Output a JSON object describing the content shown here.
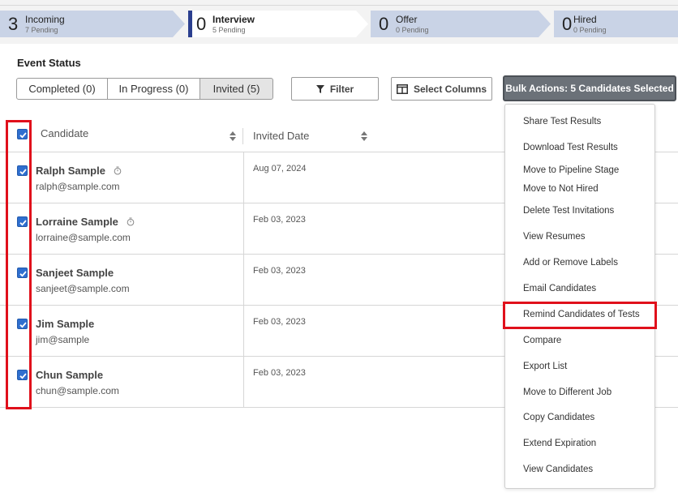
{
  "pipeline": {
    "stages": [
      {
        "count": "3",
        "name": "Incoming",
        "pending": "7 Pending"
      },
      {
        "count": "0",
        "name": "Interview",
        "pending": "5 Pending"
      },
      {
        "count": "0",
        "name": "Offer",
        "pending": "0 Pending"
      },
      {
        "count": "0",
        "name": "Hired",
        "pending": "0 Pending"
      }
    ],
    "active_stage": "Interview"
  },
  "event_status": {
    "label": "Event Status",
    "tabs": [
      "Completed (0)",
      "In Progress (0)",
      "Invited (5)"
    ],
    "selected": "Invited (5)"
  },
  "toolbar": {
    "filter_label": "Filter",
    "columns_label": "Select Columns",
    "bulk_label": "Bulk Actions: 5 Candidates Selected"
  },
  "table": {
    "headers": {
      "candidate": "Candidate",
      "invited_date": "Invited Date"
    },
    "rows": [
      {
        "name": "Ralph Sample",
        "email": "ralph@sample.com",
        "date": "Aug 07, 2024",
        "timer": true,
        "checked": true
      },
      {
        "name": "Lorraine Sample",
        "email": "lorraine@sample.com",
        "date": "Feb 03, 2023",
        "timer": true,
        "checked": true
      },
      {
        "name": "Sanjeet Sample",
        "email": "sanjeet@sample.com",
        "date": "Feb 03, 2023",
        "timer": false,
        "checked": true
      },
      {
        "name": "Jim Sample",
        "email": "jim@sample",
        "date": "Feb 03, 2023",
        "timer": false,
        "checked": true
      },
      {
        "name": "Chun Sample",
        "email": "chun@sample.com",
        "date": "Feb 03, 2023",
        "timer": false,
        "checked": true
      }
    ]
  },
  "bulk_menu": {
    "items": [
      "Share Test Results",
      "Download Test Results",
      "Move to Pipeline Stage",
      "Move to Not Hired",
      "Delete Test Invitations",
      "View Resumes",
      "Add or Remove Labels",
      "Email Candidates",
      "Remind Candidates of Tests",
      "Compare",
      "Export List",
      "Move to Different Job",
      "Copy Candidates",
      "Extend Expiration",
      "View Candidates"
    ],
    "highlighted": "Remind Candidates of Tests"
  },
  "colors": {
    "accent": "#2b3f8f",
    "stage_bg": "#c9d3e6",
    "checkbox": "#2f6fcf",
    "highlight_box": "#e0101b",
    "bulk_button": "#6b7178"
  },
  "icons": [
    "timer-icon",
    "filter-icon",
    "columns-icon",
    "sort-icon",
    "check-icon"
  ]
}
